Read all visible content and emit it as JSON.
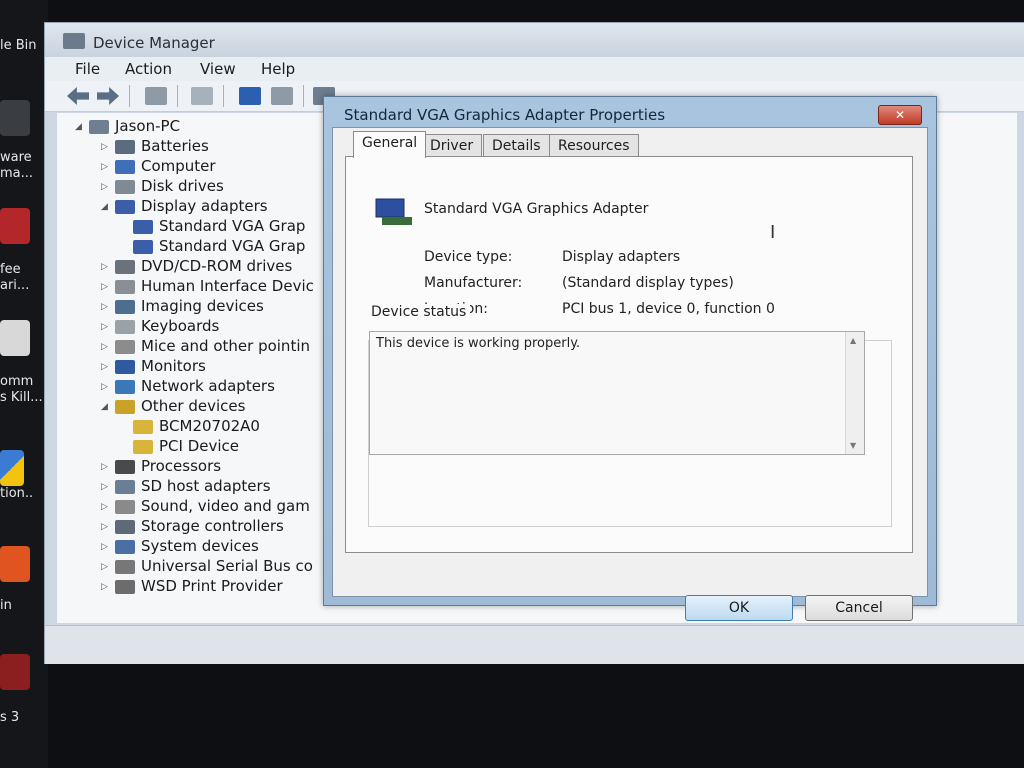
{
  "desktop": {
    "labels": [
      "le Bin",
      "ware",
      "ma...",
      "fee",
      "ari...",
      "omm",
      "s Kill...",
      "tion..",
      "in",
      "s 3"
    ]
  },
  "device_manager": {
    "title": "Device Manager",
    "menu": [
      "File",
      "Action",
      "View",
      "Help"
    ],
    "toolbar_icons": [
      "back-arrow-icon",
      "forward-arrow-icon",
      "properties-icon",
      "computer-icon",
      "help-icon",
      "console-icon",
      "scan-icon"
    ],
    "tree": {
      "root": "Jason-PC",
      "categories": [
        {
          "label": "Batteries",
          "expanded": false
        },
        {
          "label": "Computer",
          "expanded": false
        },
        {
          "label": "Disk drives",
          "expanded": false
        },
        {
          "label": "Display adapters",
          "expanded": true,
          "children": [
            "Standard VGA Grap",
            "Standard VGA Grap"
          ]
        },
        {
          "label": "DVD/CD-ROM drives",
          "expanded": false
        },
        {
          "label": "Human Interface Devic",
          "expanded": false
        },
        {
          "label": "Imaging devices",
          "expanded": false
        },
        {
          "label": "Keyboards",
          "expanded": false
        },
        {
          "label": "Mice and other pointin",
          "expanded": false
        },
        {
          "label": "Monitors",
          "expanded": false
        },
        {
          "label": "Network adapters",
          "expanded": false
        },
        {
          "label": "Other devices",
          "expanded": true,
          "children": [
            "BCM20702A0",
            "PCI Device"
          ]
        },
        {
          "label": "Processors",
          "expanded": false
        },
        {
          "label": "SD host adapters",
          "expanded": false
        },
        {
          "label": "Sound, video and gam",
          "expanded": false
        },
        {
          "label": "Storage controllers",
          "expanded": false
        },
        {
          "label": "System devices",
          "expanded": false
        },
        {
          "label": "Universal Serial Bus co",
          "expanded": false
        },
        {
          "label": "WSD Print Provider",
          "expanded": false
        }
      ]
    }
  },
  "dialog": {
    "title": "Standard VGA Graphics Adapter Properties",
    "close_label": "✕",
    "tabs": [
      "General",
      "Driver",
      "Details",
      "Resources"
    ],
    "selected_tab": "General",
    "device_name": "Standard VGA Graphics Adapter",
    "fields": [
      {
        "label": "Device type:",
        "value": "Display adapters"
      },
      {
        "label": "Manufacturer:",
        "value": "(Standard display types)"
      },
      {
        "label": "Location:",
        "value": "PCI bus 1, device 0, function 0"
      }
    ],
    "status_group_label": "Device status",
    "status_text": "This device is working properly.",
    "ok_label": "OK",
    "cancel_label": "Cancel"
  },
  "colors": {
    "dialog_frame": "#a8c4df",
    "close_red": "#c23b28",
    "default_button": "#3c7fb1"
  }
}
